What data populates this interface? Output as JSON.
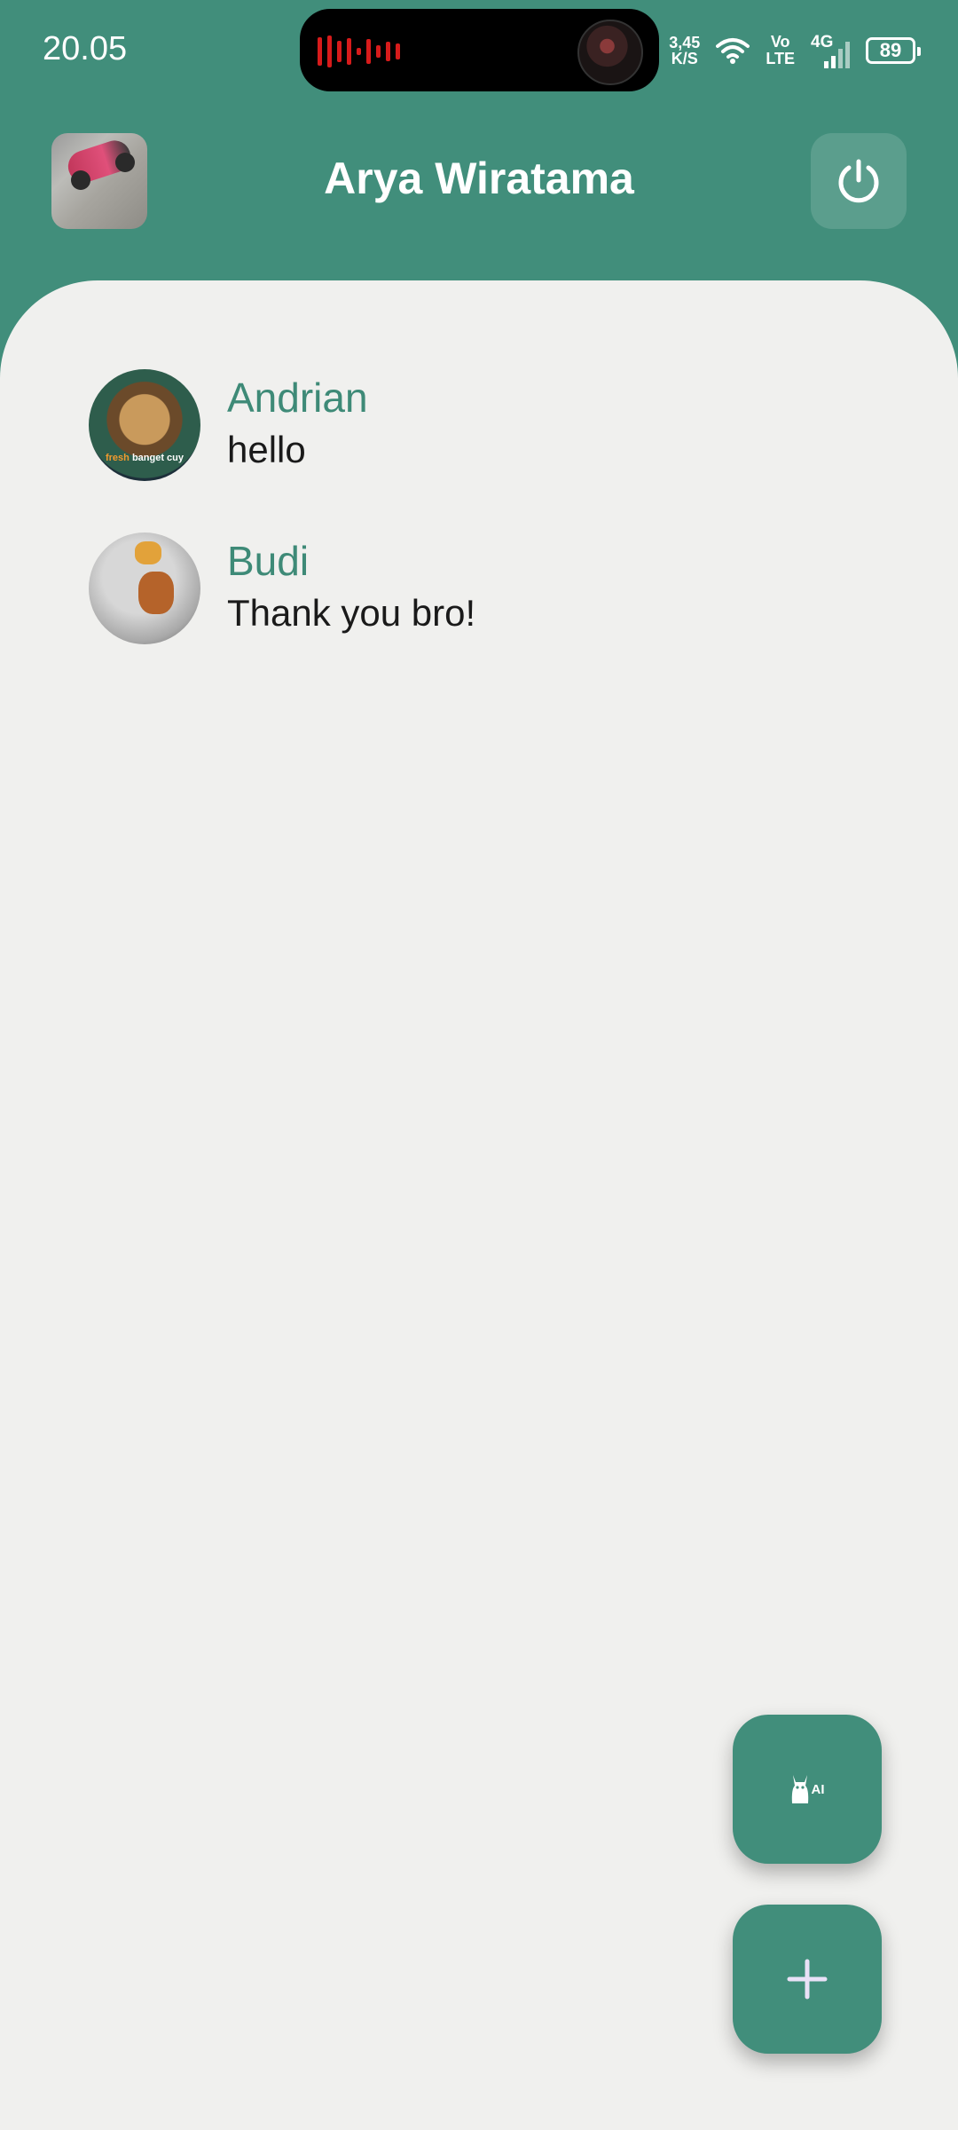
{
  "status_bar": {
    "time": "20.05",
    "net_speed_value": "3,45",
    "net_speed_unit": "K/S",
    "volte_top": "Vo",
    "volte_bottom": "LTE",
    "network_type": "4G",
    "battery": "89",
    "icons": [
      "audio-wave-icon",
      "now-playing-art",
      "wifi-icon",
      "signal-icon",
      "battery-icon"
    ]
  },
  "header": {
    "title": "Arya Wiratama",
    "profile_avatar": "profile-avatar",
    "logout_icon": "power-icon"
  },
  "chats": [
    {
      "name": "Andrian",
      "last_message": "hello",
      "avatar_caption_accent": "fresh",
      "avatar_caption_rest": " banget cuy"
    },
    {
      "name": "Budi",
      "last_message": "Thank you bro!"
    }
  ],
  "fabs": {
    "ai_label": "AI",
    "ai_icon": "llama-icon",
    "add_icon": "plus-icon"
  },
  "colors": {
    "primary": "#418e7b",
    "background": "#f0f0ee",
    "name_text": "#3e8a77",
    "message_text": "#1a1a1a"
  }
}
